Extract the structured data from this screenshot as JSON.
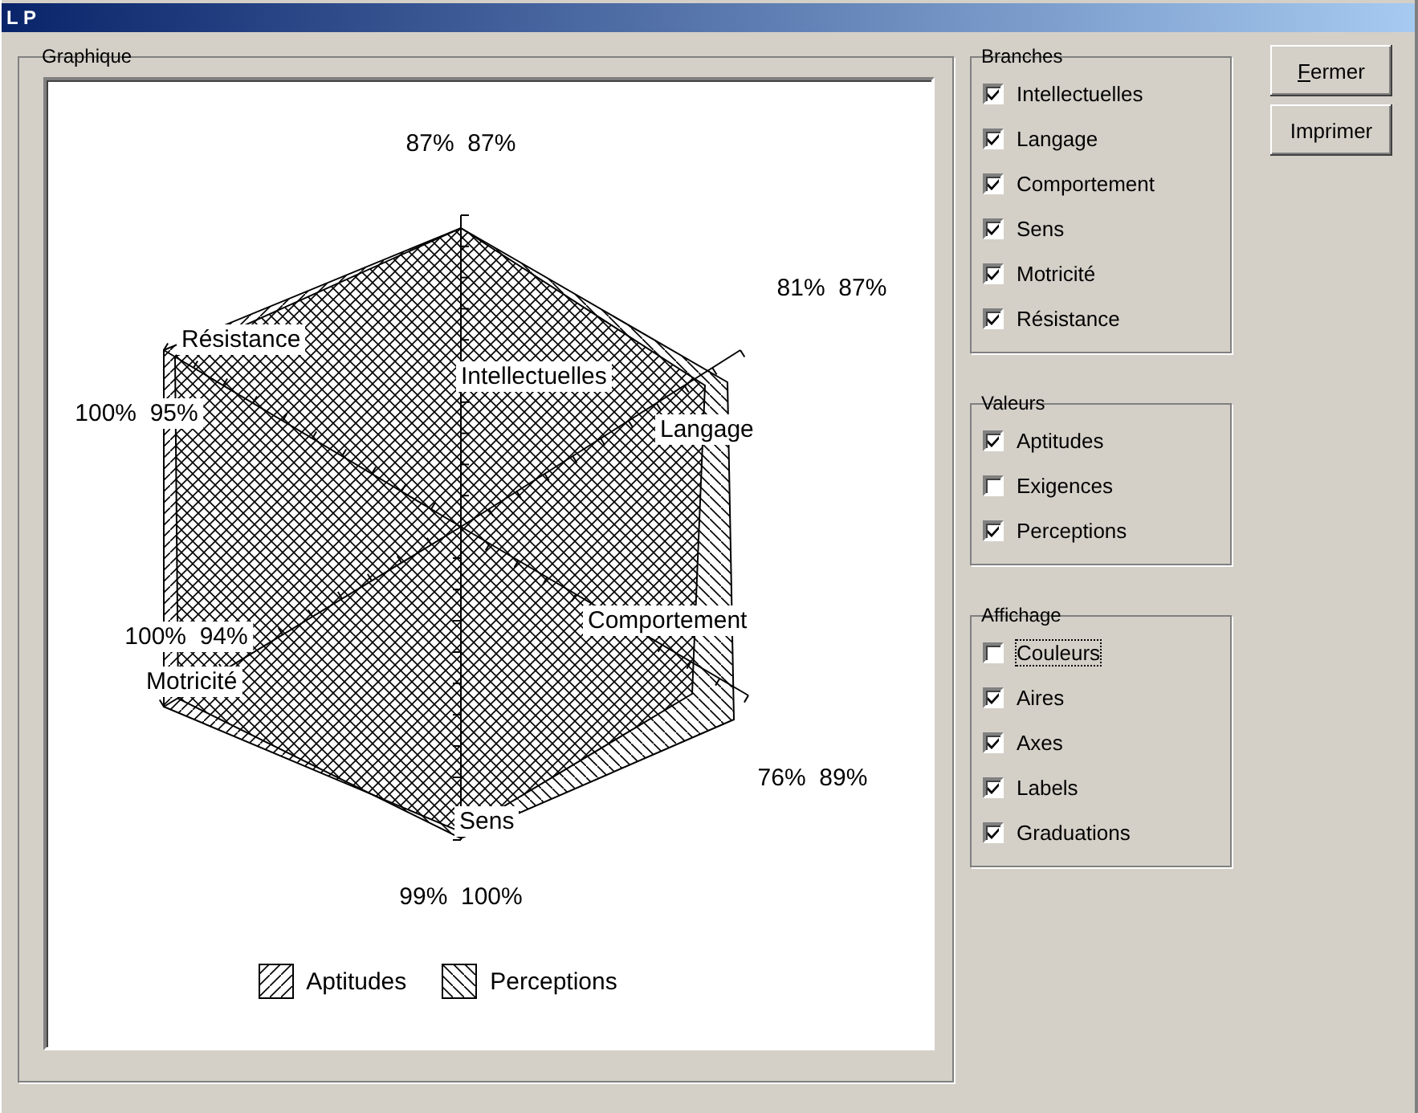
{
  "window": {
    "title": "L P"
  },
  "graph": {
    "title": "Graphique",
    "axes": [
      {
        "label": "Intellectuelles",
        "values": "87%  87%"
      },
      {
        "label": "Langage",
        "values": "81%  87%"
      },
      {
        "label": "Résistance",
        "values": "100%  95%"
      },
      {
        "label": "Motricité",
        "values": "100%  94%"
      },
      {
        "label": "Comportement",
        "values": "76%  89%"
      },
      {
        "label": "Sens",
        "values": "99%  100%"
      }
    ],
    "legend": [
      {
        "label": "Aptitudes",
        "kind": "forward"
      },
      {
        "label": "Perceptions",
        "kind": "backward"
      }
    ]
  },
  "groups": [
    {
      "title": "Branches",
      "options": [
        {
          "label": "Intellectuelles",
          "checked": true,
          "focused": false
        },
        {
          "label": "Langage",
          "checked": true,
          "focused": false
        },
        {
          "label": "Comportement",
          "checked": true,
          "focused": false
        },
        {
          "label": "Sens",
          "checked": true,
          "focused": false
        },
        {
          "label": "Motricité",
          "checked": true,
          "focused": false
        },
        {
          "label": "Résistance",
          "checked": true,
          "focused": false
        }
      ]
    },
    {
      "title": "Valeurs",
      "options": [
        {
          "label": "Aptitudes",
          "checked": true,
          "focused": false
        },
        {
          "label": "Exigences",
          "checked": false,
          "focused": false
        },
        {
          "label": "Perceptions",
          "checked": true,
          "focused": false
        }
      ]
    },
    {
      "title": "Affichage",
      "options": [
        {
          "label": "Couleurs",
          "checked": false,
          "focused": true
        },
        {
          "label": "Aires",
          "checked": true,
          "focused": false
        },
        {
          "label": "Axes",
          "checked": true,
          "focused": false
        },
        {
          "label": "Labels",
          "checked": true,
          "focused": false
        },
        {
          "label": "Graduations",
          "checked": true,
          "focused": false
        }
      ]
    }
  ],
  "buttons": [
    {
      "label": "Fermer",
      "underline_first": true
    },
    {
      "label": "Imprimer",
      "underline_first": false
    }
  ]
}
